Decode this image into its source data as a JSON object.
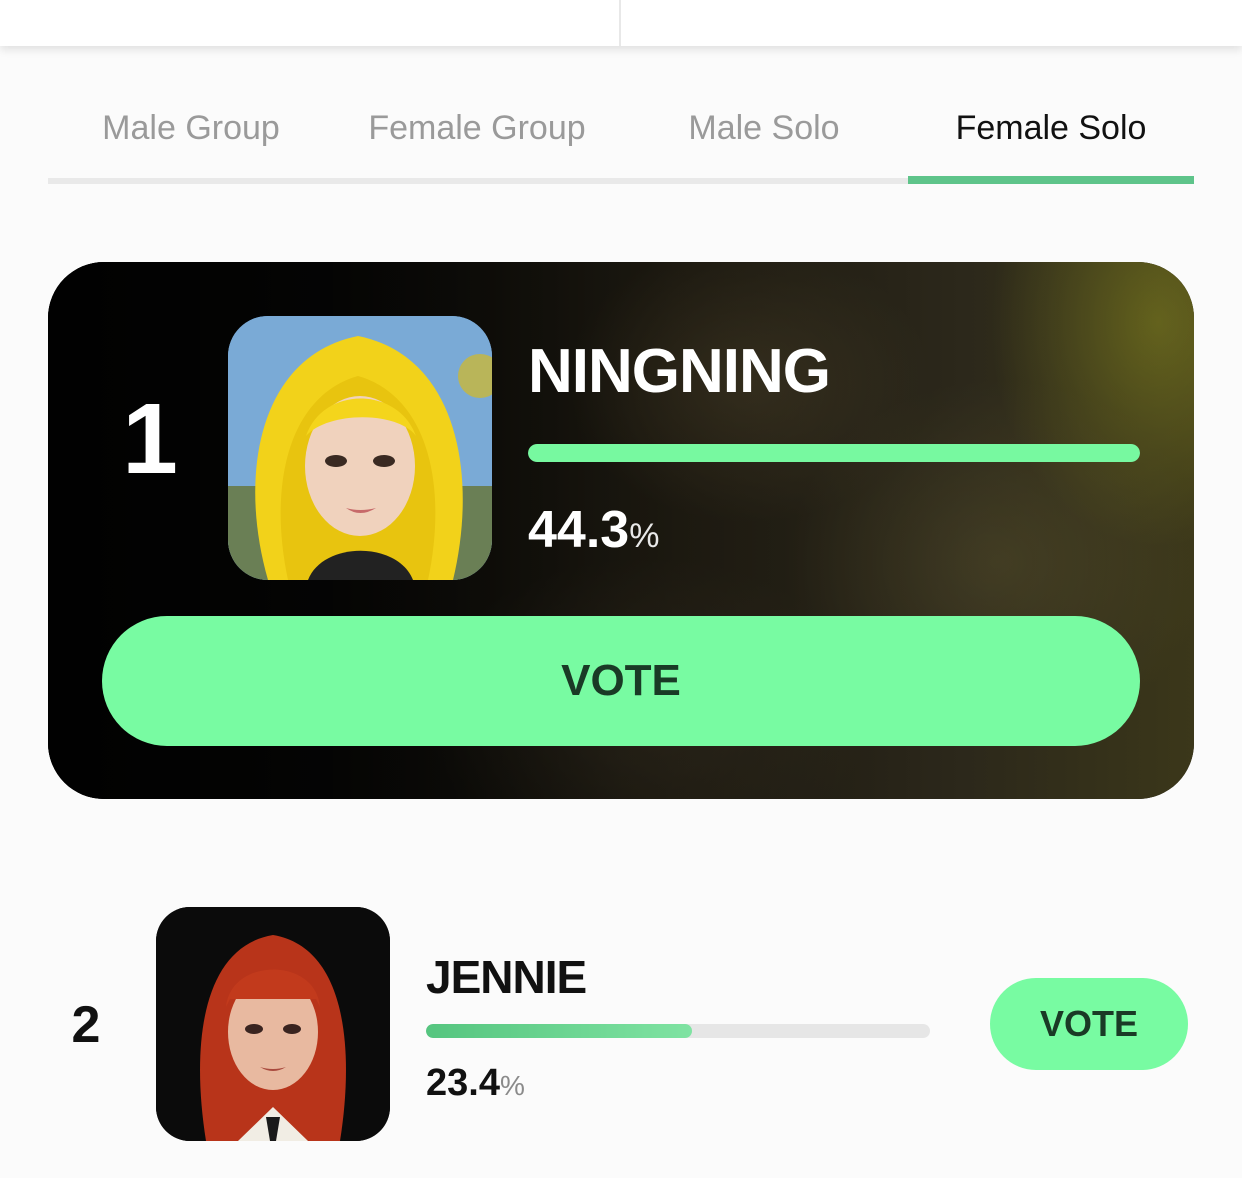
{
  "tabs": [
    {
      "label": "Male Group",
      "active": false
    },
    {
      "label": "Female Group",
      "active": false
    },
    {
      "label": "Male Solo",
      "active": false
    },
    {
      "label": "Female Solo",
      "active": true
    }
  ],
  "colors": {
    "accent": "#78fba2",
    "tab_indicator": "#5ec48a",
    "active_tab_text": "#111111",
    "inactive_tab_text": "#9a9a9a"
  },
  "ranking": [
    {
      "rank": "1",
      "name": "NINGNING",
      "percent_value": "44.3",
      "percent_unit": "%",
      "progress_fraction": 0.443,
      "vote_label": "VOTE"
    },
    {
      "rank": "2",
      "name": "JENNIE",
      "percent_value": "23.4",
      "percent_unit": "%",
      "progress_fraction": 0.234,
      "vote_label": "VOTE"
    }
  ]
}
